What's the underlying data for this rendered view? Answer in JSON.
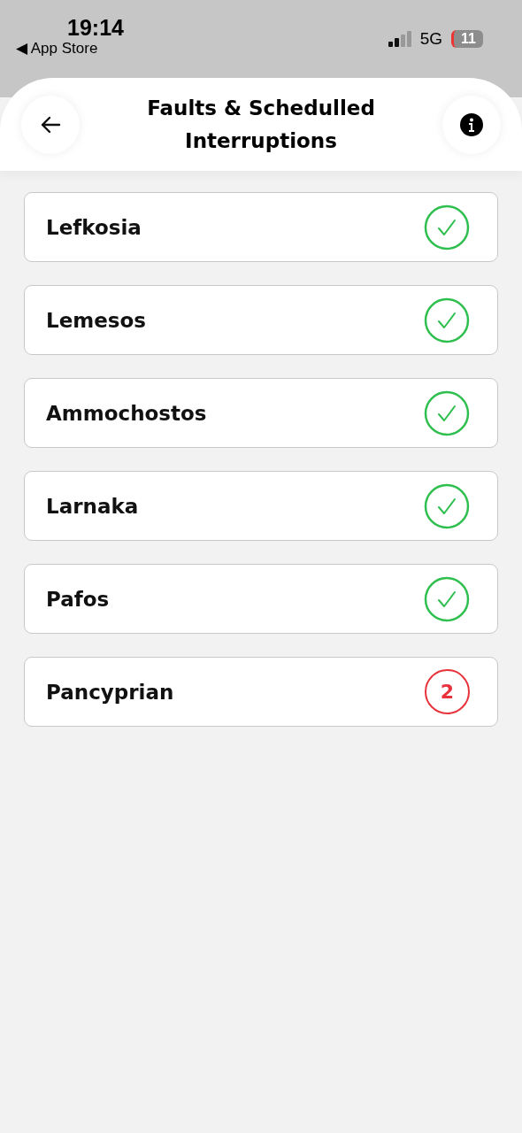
{
  "status_bar": {
    "time": "19:14",
    "back_app": "◀ App Store",
    "network": "5G",
    "battery": "11"
  },
  "header": {
    "title": "Faults & Schedulled Interruptions"
  },
  "regions": [
    {
      "name": "Lefkosia",
      "kind": "ok"
    },
    {
      "name": "Lemesos",
      "kind": "ok"
    },
    {
      "name": "Ammochostos",
      "kind": "ok"
    },
    {
      "name": "Larnaka",
      "kind": "ok"
    },
    {
      "name": "Pafos",
      "kind": "ok"
    },
    {
      "name": "Pancyprian",
      "kind": "count",
      "count": "2"
    }
  ]
}
